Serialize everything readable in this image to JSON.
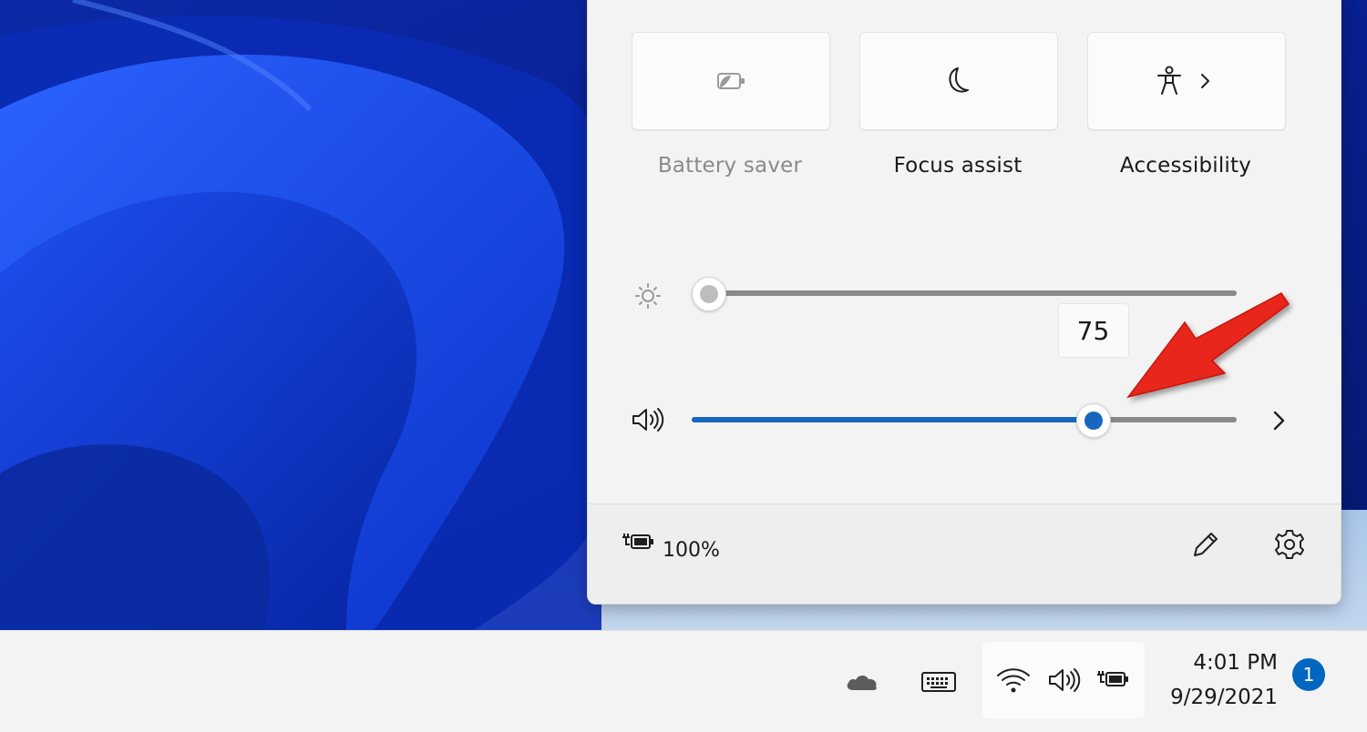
{
  "quick_settings": {
    "tiles": [
      {
        "label": "Battery saver",
        "icon": "battery-saver-icon",
        "state": "disabled"
      },
      {
        "label": "Focus assist",
        "icon": "moon-icon",
        "state": "off"
      },
      {
        "label": "Accessibility",
        "icon": "accessibility-icon",
        "state": "off",
        "has_chevron": true
      }
    ],
    "brightness": {
      "icon": "sun-icon",
      "value": 0
    },
    "volume": {
      "icon": "speaker-icon",
      "value": 75,
      "tooltip": "75"
    },
    "footer": {
      "battery_icon": "battery-charging-icon",
      "battery_percent": "100%",
      "edit_icon": "pencil-icon",
      "settings_icon": "gear-icon"
    }
  },
  "taskbar": {
    "tray_icons": [
      "onedrive-cloud-icon",
      "touch-keyboard-icon",
      "wifi-icon",
      "speaker-icon",
      "battery-charging-icon"
    ],
    "time": "4:01 PM",
    "date": "9/29/2021",
    "notification_count": "1"
  },
  "colors": {
    "accent": "#1767bf",
    "annotation_arrow": "#e8281e",
    "notification_badge": "#0067c0"
  }
}
